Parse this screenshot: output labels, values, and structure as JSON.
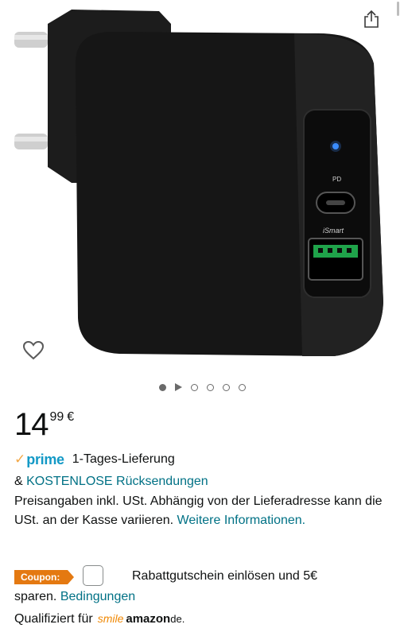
{
  "gallery": {
    "product_labels": {
      "port_c": "PD",
      "port_a": "iSmart"
    },
    "active_dot": 0,
    "dot_count": 6
  },
  "price": {
    "whole": "14",
    "fraction": "99",
    "currency": "€"
  },
  "prime": {
    "logo": "prime",
    "delivery": "1-Tages-Lieferung"
  },
  "returns": {
    "prefix": "& ",
    "link": "KOSTENLOSE Rücksendungen"
  },
  "notice": {
    "text": "Preisangaben inkl. USt. Abhängig von der Lieferadresse kann die USt. an der Kasse variieren. ",
    "link": "Weitere Informationen."
  },
  "coupon": {
    "badge": "Coupon:",
    "text_line1": "Rabattgutschein einlösen und 5€",
    "text_line2": "sparen.",
    "terms_link": "Bedingungen"
  },
  "smile": {
    "prefix": "Qualifiziert für",
    "logo_smile": "smile",
    "logo_amazon": "amazon",
    "logo_de": "de."
  },
  "colors": {
    "link": "#007185",
    "coupon": "#e47911",
    "prime": "#1399c6",
    "prime_check": "#f3a847"
  },
  "icons": [
    "share-icon",
    "heart-icon",
    "prime-check-icon",
    "play-icon"
  ]
}
